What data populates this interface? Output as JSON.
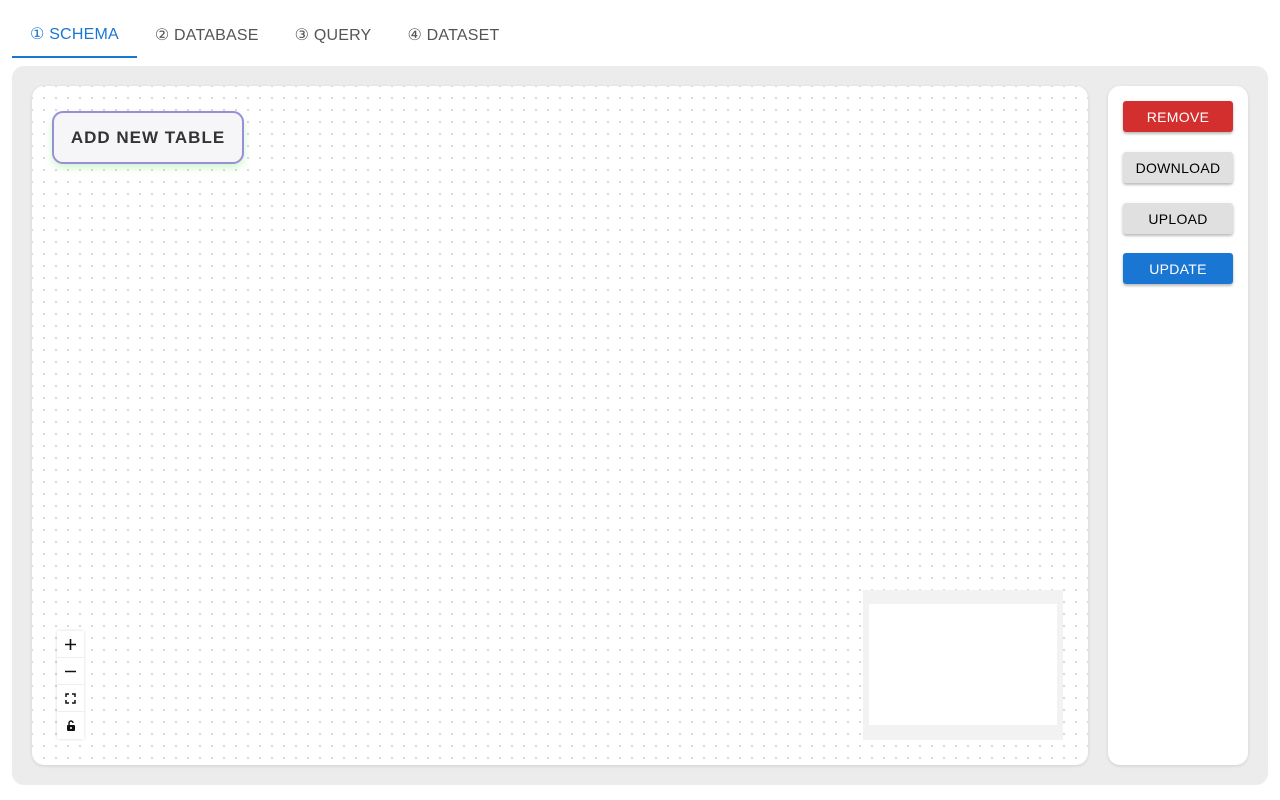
{
  "tabs": [
    {
      "label": "① SCHEMA",
      "active": true
    },
    {
      "label": "② DATABASE",
      "active": false
    },
    {
      "label": "③ QUERY",
      "active": false
    },
    {
      "label": "④ DATASET",
      "active": false
    }
  ],
  "canvas": {
    "add_table_label": "ADD NEW TABLE",
    "controls": [
      {
        "icon": "plus-icon",
        "action": "zoom-in"
      },
      {
        "icon": "minus-icon",
        "action": "zoom-out"
      },
      {
        "icon": "fit-view-icon",
        "action": "fit-view"
      },
      {
        "icon": "unlock-icon",
        "action": "toggle-interactivity"
      }
    ]
  },
  "sidebar": {
    "remove_label": "REMOVE",
    "download_label": "DOWNLOAD",
    "upload_label": "UPLOAD",
    "update_label": "UPDATE"
  },
  "colors": {
    "accent": "#1976d2",
    "danger": "#d32f2f",
    "neutral_button": "#e0e0e0",
    "node_border": "#9a8fd6"
  }
}
